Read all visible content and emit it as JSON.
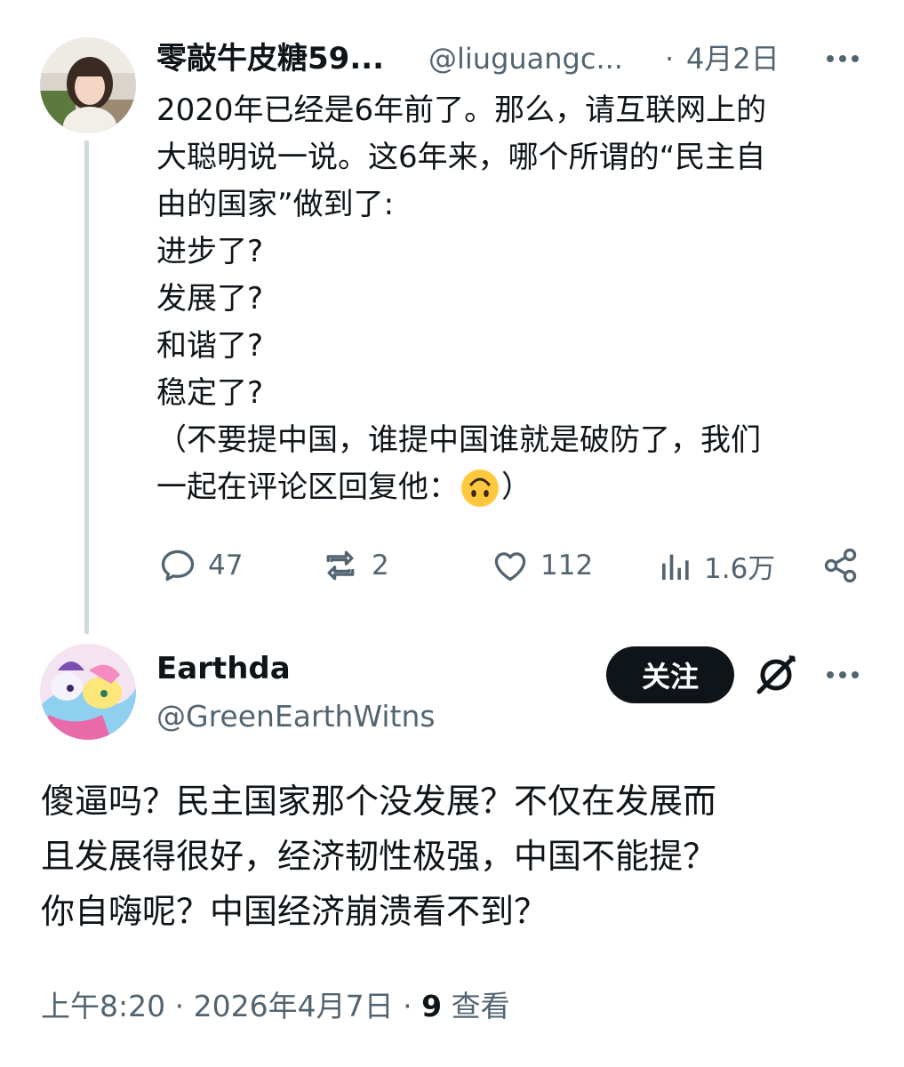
{
  "original_tweet": {
    "display_name": "零敲牛皮糖59...",
    "handle": "@liuguangc...",
    "separator": "·",
    "date": "4月2日",
    "more_icon": "ellipsis-icon",
    "text_lines": [
      "2020年已经是6年前了。那么，请互联网上的",
      "大聪明说一说。这6年来，哪个所谓的“民主自",
      "由的国家”做到了:",
      "进步了?",
      "发展了?",
      "和谐了?",
      "稳定了?",
      "（不要提中国，谁提中国谁就是破防了，我们",
      "一起在评论区回复他："
    ],
    "emoji": "upside-down-face-emoji",
    "closing_paren": "）",
    "actions": {
      "replies": "47",
      "retweets": "2",
      "likes": "112",
      "views": "1.6万"
    }
  },
  "reply_tweet": {
    "display_name": "Earthda",
    "handle": "@GreenEarthWitns",
    "follow_label": "关注",
    "grok_icon": "grok-icon",
    "more_icon": "ellipsis-icon",
    "text_lines": [
      "傻逼吗？民主国家那个没发展？不仅在发展而",
      "且发展得很好，经济韧性极强，中国不能提？",
      "你自嗨呢？中国经济崩溃看不到？"
    ],
    "footer": {
      "time": "上午8:20",
      "date": "2026年4月7日",
      "separator": "·",
      "views_count": "9",
      "views_label": "查看"
    }
  },
  "colors": {
    "text": "#0f1419",
    "secondary": "#536471",
    "thread_line": "#cfd9de",
    "follow_button": "#0f1419",
    "emoji_yellow": "#ffc83d"
  }
}
